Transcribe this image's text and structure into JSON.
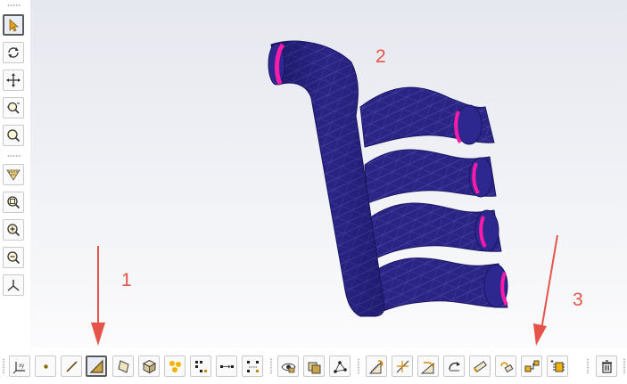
{
  "viewport": {
    "annotations": [
      {
        "label": "1"
      },
      {
        "label": "2"
      },
      {
        "label": "3"
      }
    ],
    "model": {
      "name": "exhaust-manifest-mesh",
      "mesh_color": "#25207e",
      "face_highlight": "#ff1aa8"
    },
    "arrow_color": "#e5534b"
  },
  "left_toolbar": {
    "tools": [
      {
        "icon": "select-arrow-icon"
      },
      {
        "icon": "rotate-icon"
      },
      {
        "icon": "pan-icon"
      },
      {
        "icon": "zoom-dynamic-icon"
      },
      {
        "icon": "zoom-window-icon"
      },
      {
        "icon": "section-view-icon"
      },
      {
        "icon": "zoom-fit-icon"
      },
      {
        "icon": "zoom-in-icon"
      },
      {
        "icon": "zoom-out-icon"
      },
      {
        "icon": "axes-triad-icon"
      }
    ]
  },
  "bottom_toolbar": {
    "tools": [
      {
        "icon": "coordinate-system-icon"
      },
      {
        "icon": "point-icon"
      },
      {
        "icon": "line-icon"
      },
      {
        "icon": "triangle-face-icon",
        "selected": true
      },
      {
        "icon": "face-icon"
      },
      {
        "icon": "box-solid-icon"
      },
      {
        "icon": "multi-sphere-icon"
      },
      {
        "icon": "grid-points-icon"
      },
      {
        "icon": "point-to-point-icon"
      },
      {
        "icon": "bounding-points-icon"
      },
      {
        "icon": "show-hide-icon"
      },
      {
        "icon": "solid-stack-icon"
      },
      {
        "icon": "node-network-icon"
      },
      {
        "icon": "face-split-icon"
      },
      {
        "icon": "face-merge-icon"
      },
      {
        "icon": "edge-collapse-icon"
      },
      {
        "icon": "edge-swap-icon"
      },
      {
        "icon": "cylinder-icon"
      },
      {
        "icon": "sweep-icon"
      },
      {
        "icon": "mesh-transfer-icon"
      },
      {
        "icon": "element-select-icon"
      },
      {
        "icon": "delete-icon"
      }
    ]
  }
}
